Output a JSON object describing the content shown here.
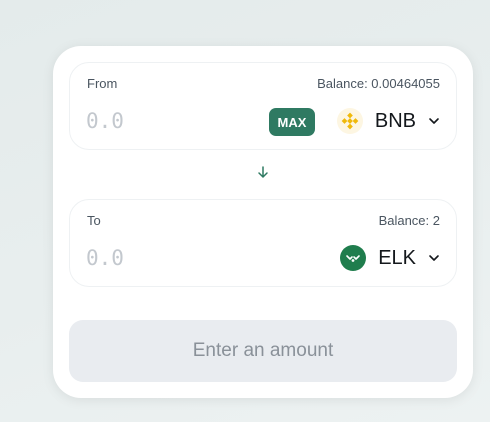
{
  "swap": {
    "from": {
      "label": "From",
      "balance": "Balance: 0.00464055",
      "amount_placeholder": "0.0",
      "amount_value": "",
      "max_label": "MAX",
      "token": {
        "symbol": "BNB",
        "icon": "bnb-icon"
      }
    },
    "switch_icon": "arrow-down-icon",
    "to": {
      "label": "To",
      "balance": "Balance: 2",
      "amount_placeholder": "0.0",
      "amount_value": "",
      "token": {
        "symbol": "ELK",
        "icon": "elk-icon"
      }
    },
    "submit_label": "Enter an amount"
  },
  "colors": {
    "accent": "#2f7a62",
    "bnb": "#f0b90b",
    "elk": "#1f7d4d",
    "disabled_bg": "#e9ecf0",
    "disabled_text": "#8a9199"
  }
}
